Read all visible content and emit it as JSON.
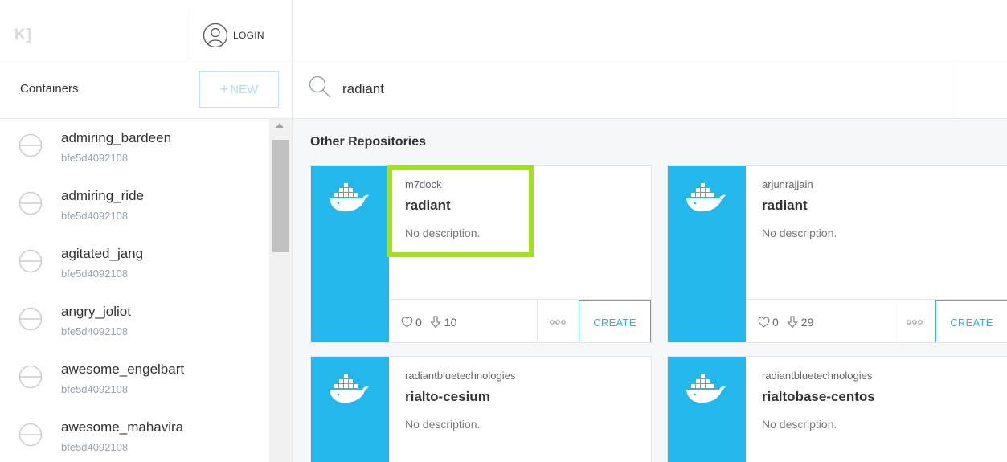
{
  "app": {
    "logo_text": "K]"
  },
  "header": {
    "login_label": "LOGIN"
  },
  "sidebar": {
    "title": "Containers",
    "new_button_label": "NEW",
    "containers": [
      {
        "name": "admiring_bardeen",
        "id": "bfe5d4092108"
      },
      {
        "name": "admiring_ride",
        "id": "bfe5d4092108"
      },
      {
        "name": "agitated_jang",
        "id": "bfe5d4092108"
      },
      {
        "name": "angry_joliot",
        "id": "bfe5d4092108"
      },
      {
        "name": "awesome_engelbart",
        "id": "bfe5d4092108"
      },
      {
        "name": "awesome_mahavira",
        "id": "bfe5d4092108"
      }
    ]
  },
  "search": {
    "query": "radiant"
  },
  "results": {
    "section_title": "Other Repositories",
    "repos": [
      {
        "owner": "m7dock",
        "name": "radiant",
        "description": "No description.",
        "stars": "0",
        "pulls": "10",
        "create_label": "CREATE"
      },
      {
        "owner": "arjunrajjain",
        "name": "radiant",
        "description": "No description.",
        "stars": "0",
        "pulls": "29",
        "create_label": "CREATE"
      },
      {
        "owner": "radiantbluetechnologies",
        "name": "rialto-cesium",
        "description": "No description."
      },
      {
        "owner": "radiantbluetechnologies",
        "name": "rialtobase-centos",
        "description": "No description."
      }
    ]
  },
  "colors": {
    "accent": "#22b8eb",
    "highlight": "#a4e01c",
    "results_bg": "#f5f7f9"
  },
  "icons": {
    "login": "user-circle-icon",
    "search": "search-icon",
    "container_status": "stopped-circle-icon",
    "repo_logo": "docker-whale-icon",
    "stars": "heart-icon",
    "pulls": "download-arrow-icon",
    "menu": "more-dots-icon"
  }
}
